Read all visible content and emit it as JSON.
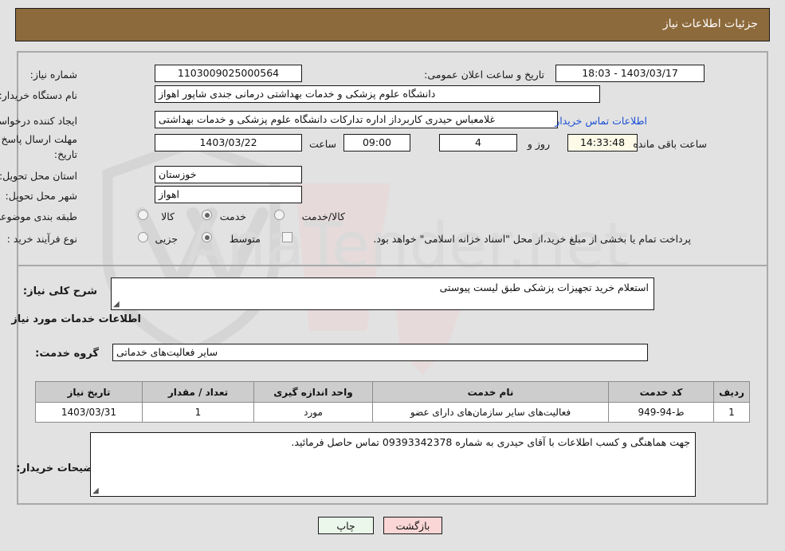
{
  "header": {
    "title": "جزئیات اطلاعات نیاز",
    "bar_color": "#8d6a3b"
  },
  "info": {
    "need_number_label": "شماره نیاز:",
    "need_number_value": "1103009025000564",
    "announce_datetime_label": "تاریخ و ساعت اعلان عمومی:",
    "announce_datetime_value": "1403/03/17 - 18:03",
    "buyer_org_label": "نام دستگاه خریدار:",
    "buyer_org_value": "دانشگاه علوم پزشکی و خدمات بهداشتی درمانی جندی شاپور اهواز",
    "requester_label": "ایجاد کننده درخواست:",
    "requester_value": "غلامعباس حیدری کاربرداز اداره تدارکات دانشگاه علوم پزشکی و خدمات بهداشتی",
    "contact_link": "اطلاعات تماس خریدار",
    "deadline_label_line1": "مهلت ارسال پاسخ: تا",
    "deadline_label_line2": "تاریخ:",
    "deadline_date": "1403/03/22",
    "deadline_hour_label": "ساعت",
    "deadline_hour_value": "09:00",
    "remaining_days_value": "4",
    "remaining_days_label": "روز و",
    "remaining_time_value": "14:33:48",
    "remaining_time_label": "ساعت باقی مانده",
    "province_label": "استان محل تحویل:",
    "province_value": "خوزستان",
    "city_label": "شهر محل تحویل:",
    "city_value": "اهواز",
    "category_label": "طبقه بندی موضوعی:",
    "category_options": [
      {
        "label": "کالا",
        "selected": false
      },
      {
        "label": "خدمت",
        "selected": true
      },
      {
        "label": "کالا/خدمت",
        "selected": false
      }
    ],
    "purchase_type_label": "نوع فرآیند خرید :",
    "purchase_type_options": [
      {
        "label": "جزیی",
        "selected": false
      },
      {
        "label": "متوسط",
        "selected": true
      }
    ],
    "treasury_checkbox_label": "پرداخت تمام یا بخشی از مبلغ خرید،از محل \"اسناد خزانه اسلامی\" خواهد بود.",
    "treasury_checkbox_checked": false
  },
  "details": {
    "general_desc_label": "شرح کلی نیاز:",
    "general_desc_value": "استعلام خرید تجهیزات پزشکی طبق لیست پیوستی",
    "services_section_title": "اطلاعات خدمات مورد نیاز",
    "service_group_label": "گروه خدمت:",
    "service_group_value": "سایر فعالیت‌های خدماتی",
    "buyer_notes_label": "توضیحات خریدار:",
    "buyer_notes_value": "جهت هماهنگی و کسب اطلاعات با آقای حیدری به شماره 09393342378 تماس حاصل فرمائید."
  },
  "table": {
    "columns": [
      "ردیف",
      "کد خدمت",
      "نام خدمت",
      "واحد اندازه گیری",
      "تعداد / مقدار",
      "تاریخ نیاز"
    ],
    "rows": [
      {
        "row": "1",
        "service_code": "ط-94-949",
        "service_name": "فعالیت‌های سایر سازمان‌های دارای عضو",
        "unit": "مورد",
        "quantity": "1",
        "need_date": "1403/03/31"
      }
    ]
  },
  "footer": {
    "print_label": "چاپ",
    "back_label": "بازگشت"
  },
  "watermark": {
    "text": "AnaTender.net"
  }
}
